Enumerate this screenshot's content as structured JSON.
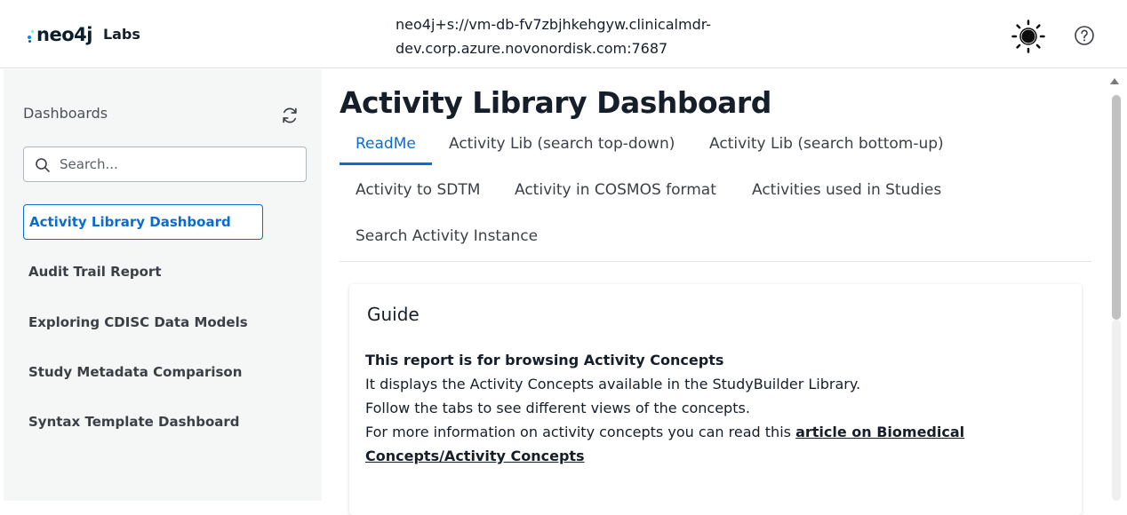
{
  "header": {
    "logo_word": "neo4j",
    "logo_labs": "Labs",
    "connection_line1": "neo4j+s://vm-db-fv7zbjhkehgyw.clinicalmdr-",
    "connection_line2": "dev.corp.azure.novonordisk.com:7687",
    "theme_icon": "sun-icon",
    "help_icon": "help-circle-icon"
  },
  "sidebar": {
    "title": "Dashboards",
    "refresh_icon": "refresh-icon",
    "search_placeholder": "Search...",
    "items": [
      {
        "label": "Activity Library Dashboard",
        "active": true
      },
      {
        "label": "Audit Trail Report"
      },
      {
        "label": "Exploring CDISC Data Models"
      },
      {
        "label": "Study Metadata Comparison"
      },
      {
        "label": "Syntax Template Dashboard"
      }
    ]
  },
  "main": {
    "title": "Activity Library Dashboard",
    "tabs": [
      {
        "label": "ReadMe",
        "active": true
      },
      {
        "label": "Activity Lib (search top-down)"
      },
      {
        "label": "Activity Lib (search bottom-up)"
      },
      {
        "label": "Activity to SDTM"
      },
      {
        "label": "Activity in COSMOS format"
      },
      {
        "label": "Activities used in Studies"
      },
      {
        "label": "Search Activity Instance"
      }
    ],
    "card": {
      "title": "Guide",
      "heading": "This report is for browsing Activity Concepts",
      "line1": "It displays the Activity Concepts available in the StudyBuilder Library.",
      "line2": "Follow the tabs to see different views of the concepts.",
      "line3_prefix": "For more information on activity concepts you can read this ",
      "link_text": "article on Biomedical Concepts/Activity Concepts"
    }
  },
  "colors": {
    "accent": "#0a6cd0",
    "sidebar_bg": "#f5f6f6",
    "logo_dot_1": "#018bff",
    "logo_dot_2": "#55f9e2",
    "logo_dot_3": "#0a6190"
  }
}
